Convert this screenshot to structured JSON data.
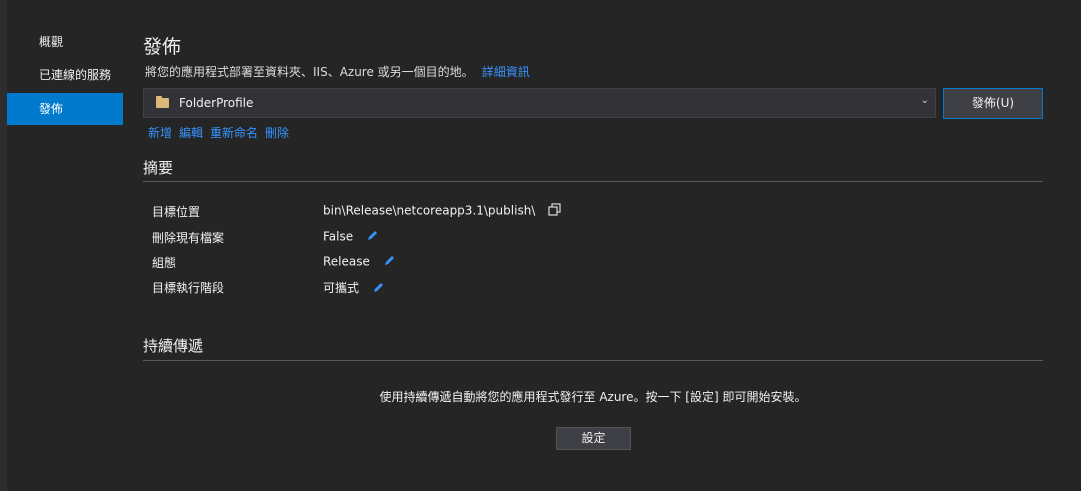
{
  "sidebar": {
    "items": [
      {
        "label": "概觀"
      },
      {
        "label": "已連線的服務"
      },
      {
        "label": "發佈"
      }
    ]
  },
  "header": {
    "title": "發佈",
    "subtitle": "將您的應用程式部署至資料夾、IIS、Azure 或另一個目的地。",
    "details_link": "詳細資訊"
  },
  "profile": {
    "name": "FolderProfile",
    "publish_label": "發佈(U)"
  },
  "actions": {
    "new": "新增",
    "edit": "編輯",
    "rename": "重新命名",
    "delete": "刪除"
  },
  "summary": {
    "title": "摘要",
    "rows": [
      {
        "label": "目標位置",
        "value": "bin\\Release\\netcoreapp3.1\\publish\\"
      },
      {
        "label": "刪除現有檔案",
        "value": "False"
      },
      {
        "label": "組態",
        "value": "Release"
      },
      {
        "label": "目標執行階段",
        "value": "可攜式"
      }
    ]
  },
  "cd": {
    "title": "持續傳遞",
    "description": "使用持續傳遞自動將您的應用程式發行至 Azure。按一下 [設定] 即可開始安裝。",
    "settings_label": "設定"
  },
  "colors": {
    "background": "#252526",
    "accent": "#007acc",
    "link": "#3794ff",
    "folder": "#dcb67a",
    "pencil": "#3794ff"
  }
}
